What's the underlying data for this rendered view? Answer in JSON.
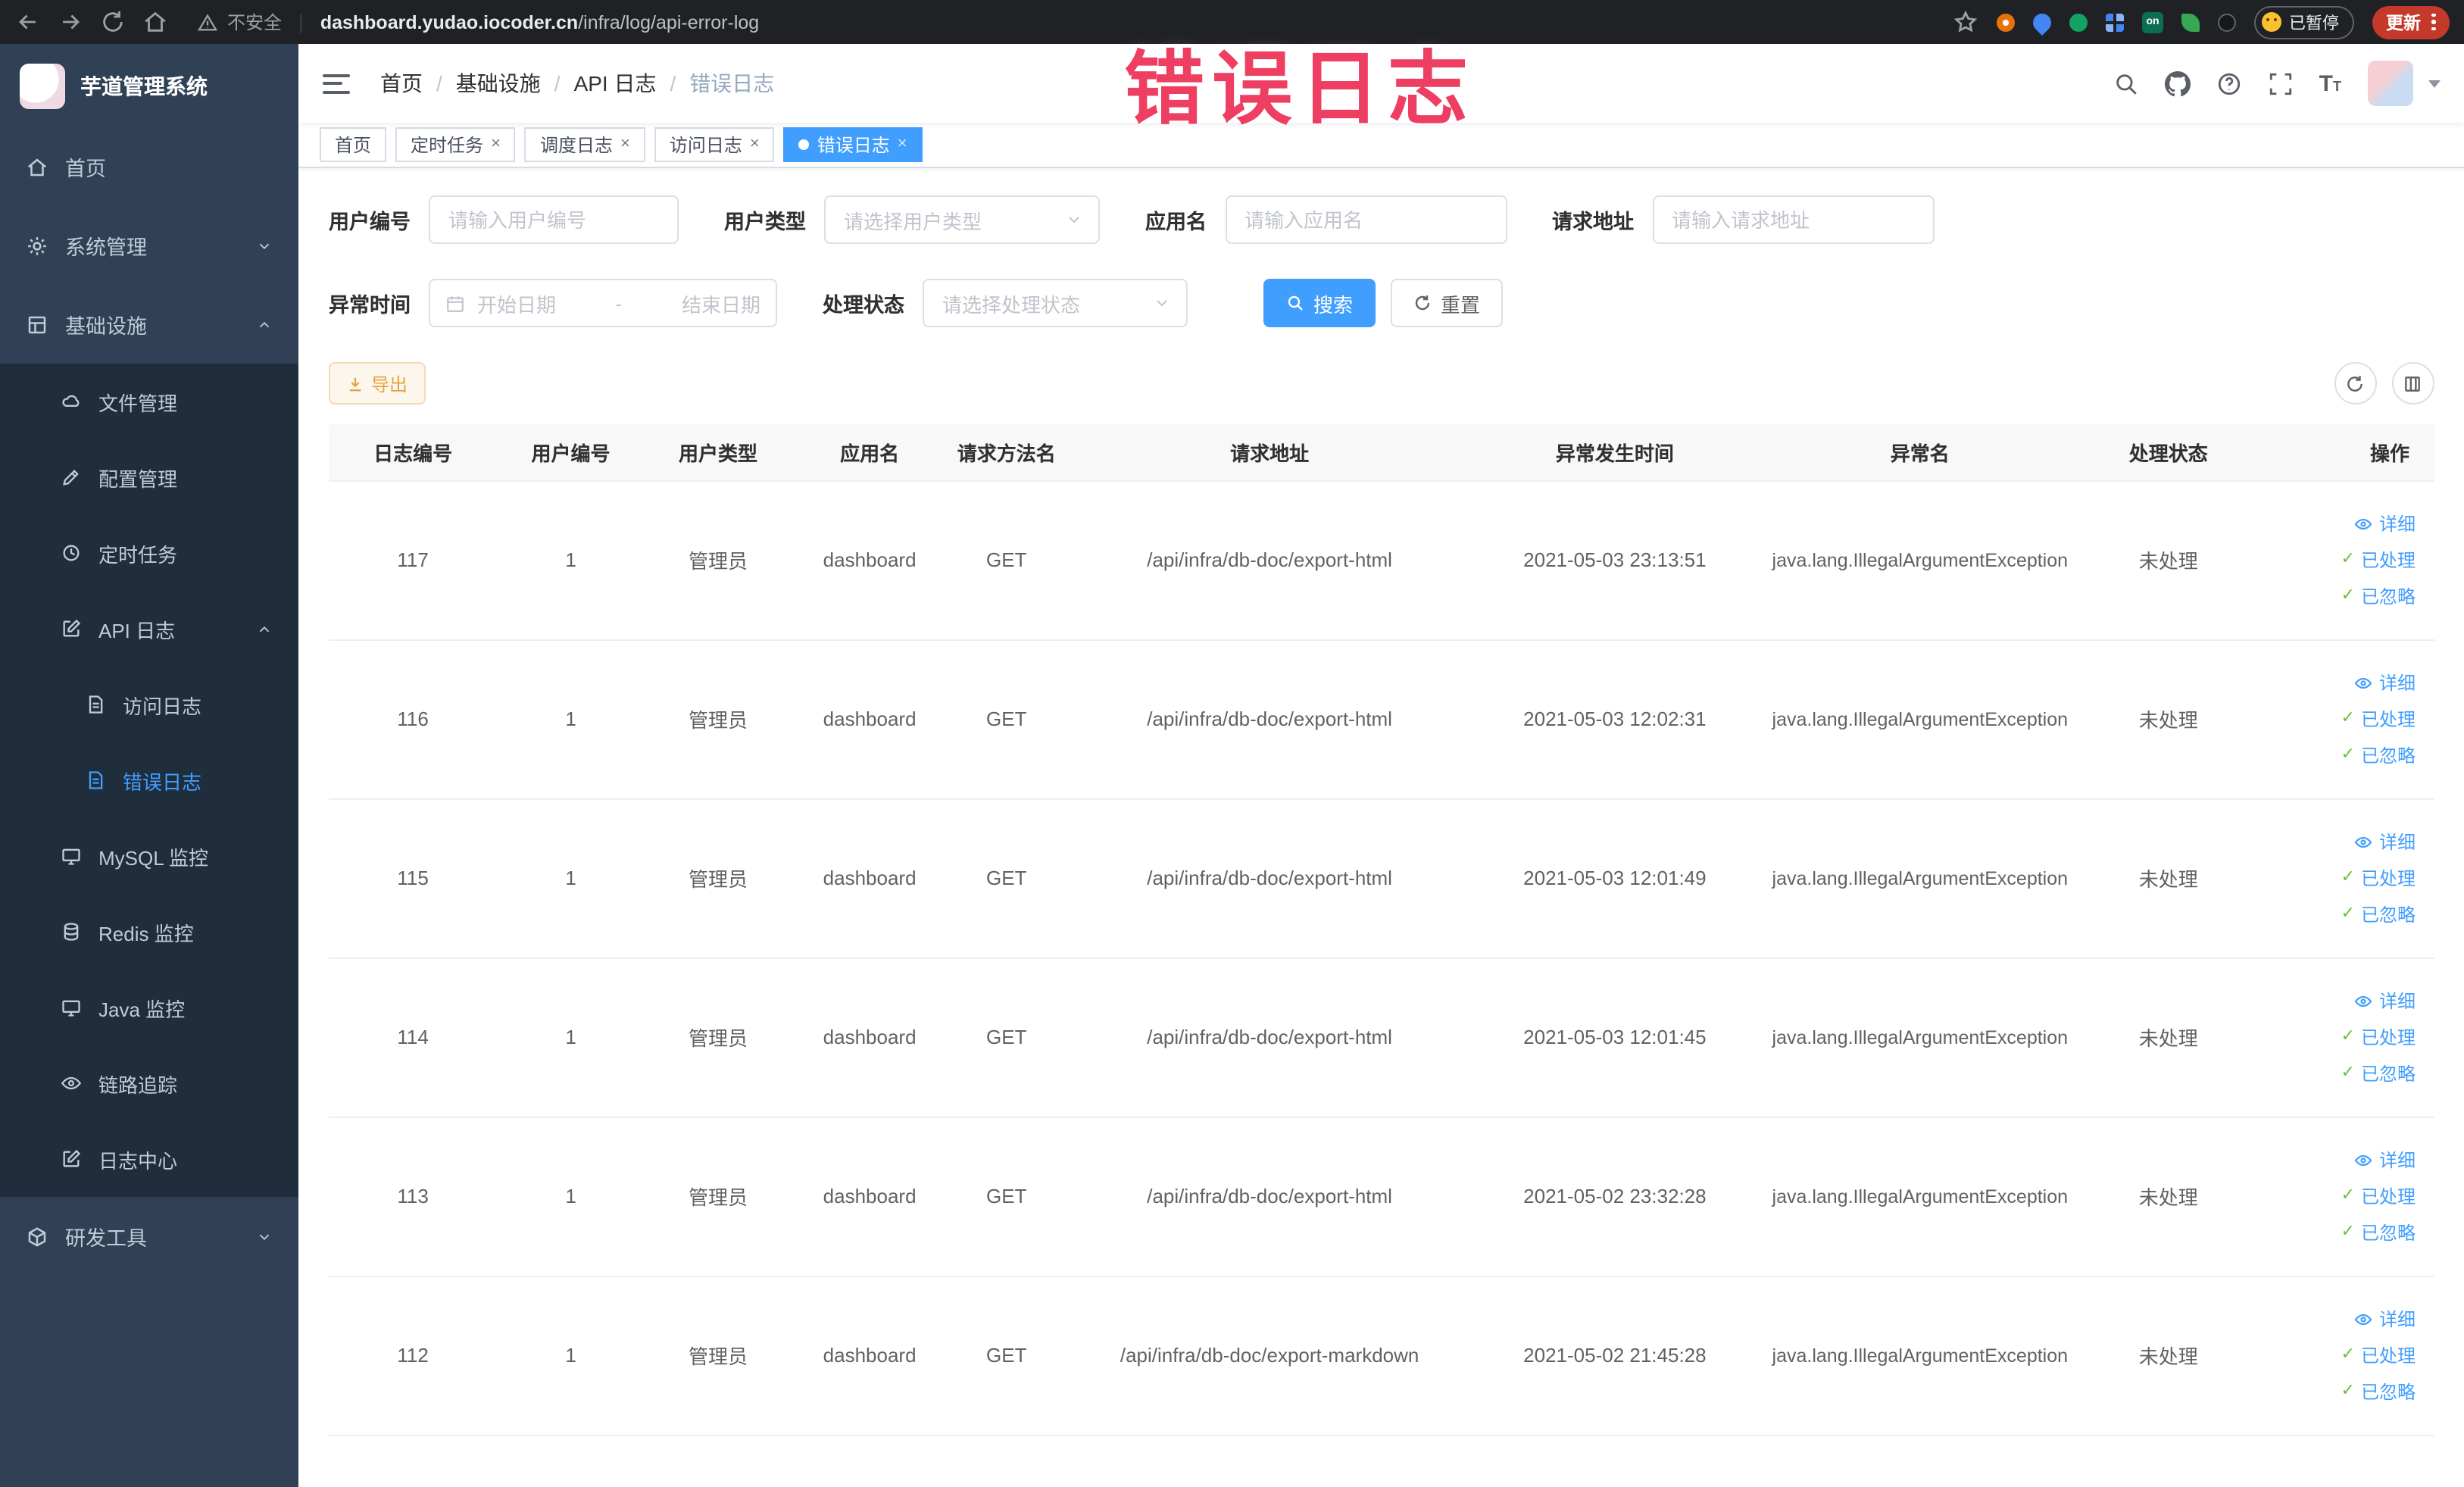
{
  "theme": {
    "accent": "#409eff",
    "sidebar_bg": "#304156",
    "submenu_bg": "#1f2d3d",
    "sidebar_text": "#bfcbd9",
    "annotation_color": "#ee3f63",
    "warning": "#e6a23c",
    "success": "#67c23a",
    "update_button_bg": "#c5392b"
  },
  "annotation": {
    "text": "错误日志"
  },
  "browser": {
    "security_label": "不安全",
    "url_domain": "dashboard.yudao.iocoder.cn",
    "url_path": "/infra/log/api-error-log",
    "extension_on_label": "on",
    "paused_badge": "已暂停",
    "update_button": "更新"
  },
  "sidebar": {
    "logo_title": "芋道管理系统",
    "items": [
      {
        "label": "首页"
      },
      {
        "label": "系统管理"
      },
      {
        "label": "基础设施",
        "children": [
          {
            "label": "文件管理"
          },
          {
            "label": "配置管理"
          },
          {
            "label": "定时任务"
          },
          {
            "label": "API 日志",
            "children": [
              {
                "label": "访问日志"
              },
              {
                "label": "错误日志"
              }
            ]
          },
          {
            "label": "MySQL 监控"
          },
          {
            "label": "Redis 监控"
          },
          {
            "label": "Java 监控"
          },
          {
            "label": "链路追踪"
          },
          {
            "label": "日志中心"
          }
        ]
      },
      {
        "label": "研发工具"
      }
    ]
  },
  "header": {
    "breadcrumb": [
      "首页",
      "基础设施",
      "API 日志",
      "错误日志"
    ]
  },
  "tabs": [
    {
      "label": "首页"
    },
    {
      "label": "定时任务"
    },
    {
      "label": "调度日志"
    },
    {
      "label": "访问日志"
    },
    {
      "label": "错误日志"
    }
  ],
  "filters": {
    "user_id": {
      "label": "用户编号",
      "placeholder": "请输入用户编号"
    },
    "user_type": {
      "label": "用户类型",
      "placeholder": "请选择用户类型"
    },
    "app_name": {
      "label": "应用名",
      "placeholder": "请输入应用名"
    },
    "request_url": {
      "label": "请求地址",
      "placeholder": "请输入请求地址"
    },
    "exception_time": {
      "label": "异常时间",
      "start_placeholder": "开始日期",
      "separator": "-",
      "end_placeholder": "结束日期"
    },
    "process_status": {
      "label": "处理状态",
      "placeholder": "请选择处理状态"
    },
    "search_button": "搜索",
    "reset_button": "重置"
  },
  "toolbar": {
    "export_button": "导出"
  },
  "table": {
    "columns": [
      "日志编号",
      "用户编号",
      "用户类型",
      "应用名",
      "请求方法名",
      "请求地址",
      "异常发生时间",
      "异常名",
      "处理状态",
      "操作"
    ],
    "action_labels": {
      "detail": "详细",
      "processed": "已处理",
      "ignored": "已忽略"
    },
    "rows": [
      {
        "id": "117",
        "user_id": "1",
        "user_type": "管理员",
        "app_name": "dashboard",
        "method": "GET",
        "url": "/api/infra/db-doc/export-html",
        "time": "2021-05-03 23:13:51",
        "exception": "java.lang.IllegalArgumentException",
        "status": "未处理"
      },
      {
        "id": "116",
        "user_id": "1",
        "user_type": "管理员",
        "app_name": "dashboard",
        "method": "GET",
        "url": "/api/infra/db-doc/export-html",
        "time": "2021-05-03 12:02:31",
        "exception": "java.lang.IllegalArgumentException",
        "status": "未处理"
      },
      {
        "id": "115",
        "user_id": "1",
        "user_type": "管理员",
        "app_name": "dashboard",
        "method": "GET",
        "url": "/api/infra/db-doc/export-html",
        "time": "2021-05-03 12:01:49",
        "exception": "java.lang.IllegalArgumentException",
        "status": "未处理"
      },
      {
        "id": "114",
        "user_id": "1",
        "user_type": "管理员",
        "app_name": "dashboard",
        "method": "GET",
        "url": "/api/infra/db-doc/export-html",
        "time": "2021-05-03 12:01:45",
        "exception": "java.lang.IllegalArgumentException",
        "status": "未处理"
      },
      {
        "id": "113",
        "user_id": "1",
        "user_type": "管理员",
        "app_name": "dashboard",
        "method": "GET",
        "url": "/api/infra/db-doc/export-html",
        "time": "2021-05-02 23:32:28",
        "exception": "java.lang.IllegalArgumentException",
        "status": "未处理"
      },
      {
        "id": "112",
        "user_id": "1",
        "user_type": "管理员",
        "app_name": "dashboard",
        "method": "GET",
        "url": "/api/infra/db-doc/export-markdown",
        "time": "2021-05-02 21:45:28",
        "exception": "java.lang.IllegalArgumentException",
        "status": "未处理"
      }
    ]
  }
}
